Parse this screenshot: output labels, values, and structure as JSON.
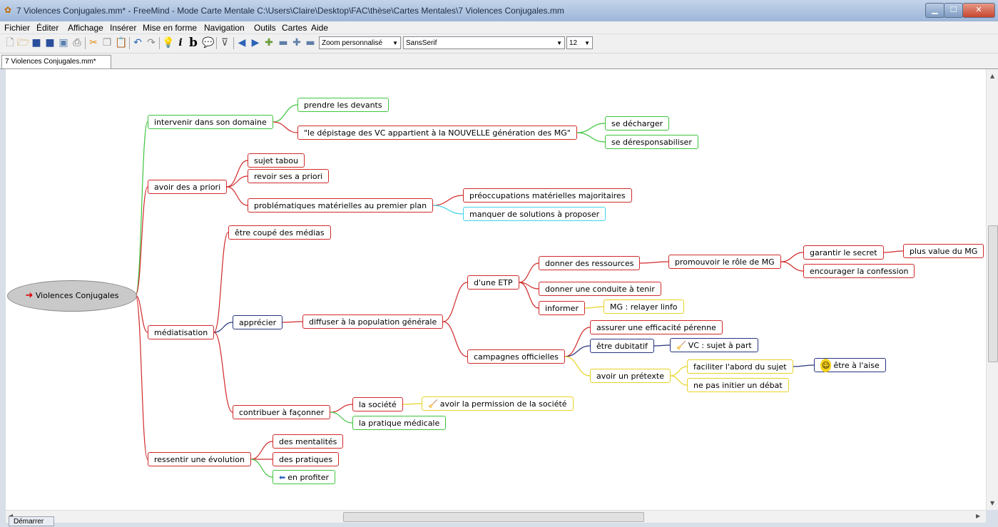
{
  "window": {
    "title": "7 Violences Conjugales.mm* - FreeMind - Mode Carte Mentale C:\\Users\\Claire\\Desktop\\FAC\\thèse\\Cartes Mentales\\7 Violences Conjugales.mm"
  },
  "menu": [
    "Fichier",
    "Éditer",
    "Affichage",
    "Insérer",
    "Mise en forme",
    "Navigation",
    "Outils",
    "Cartes",
    "Aide"
  ],
  "toolbar": {
    "zoom": "Zoom personnalisé",
    "font": "SansSerif",
    "size": "12"
  },
  "tab": {
    "label": "7 Violences Conjugales.mm*"
  },
  "taskbar": {
    "start": "Démarrer"
  },
  "mindmap": {
    "root": "Violences Conjugales",
    "branches": [
      {
        "label": "intervenir dans son domaine",
        "color": "#3ec43e",
        "children": [
          {
            "label": "prendre les devants",
            "color": "#3ec43e"
          },
          {
            "label": "\"le dépistage des VC appartient à la NOUVELLE génération des MG\"",
            "color": "#d12a2a",
            "children": [
              {
                "label": "se décharger",
                "color": "#3ec43e"
              },
              {
                "label": "se déresponsabiliser",
                "color": "#3ec43e"
              }
            ]
          }
        ]
      },
      {
        "label": "avoir des a priori",
        "color": "#d12a2a",
        "children": [
          {
            "label": "sujet tabou",
            "color": "#d12a2a"
          },
          {
            "label": "revoir ses a priori",
            "color": "#d12a2a"
          },
          {
            "label": "problématiques matérielles au premier plan",
            "color": "#d12a2a",
            "children": [
              {
                "label": "préoccupations matérielles majoritaires",
                "color": "#d12a2a"
              },
              {
                "label": "manquer de solutions à proposer",
                "color": "#3fd6e6"
              }
            ]
          }
        ]
      },
      {
        "label": "médiatisation",
        "color": "#d12a2a",
        "children": [
          {
            "label": "être coupé des médias",
            "color": "#d12a2a"
          },
          {
            "label": "apprécier",
            "color": "#27357c",
            "children": [
              {
                "label": "diffuser à la population générale",
                "color": "#d12a2a",
                "children": [
                  {
                    "label": "d'une ETP",
                    "color": "#d12a2a",
                    "children": [
                      {
                        "label": "donner des ressources",
                        "color": "#d12a2a",
                        "children": [
                          {
                            "label": "promouvoir le rôle de MG",
                            "color": "#d12a2a",
                            "children": [
                              {
                                "label": "garantir le secret",
                                "color": "#d12a2a",
                                "children": [
                                  {
                                    "label": "plus value du MG",
                                    "color": "#d12a2a"
                                  }
                                ]
                              },
                              {
                                "label": "encourager la confession",
                                "color": "#d12a2a"
                              }
                            ]
                          }
                        ]
                      },
                      {
                        "label": "donner une conduite à tenir",
                        "color": "#d12a2a"
                      },
                      {
                        "label": "informer",
                        "color": "#d12a2a",
                        "children": [
                          {
                            "label": "MG : relayer linfo",
                            "color": "#e8d327"
                          }
                        ]
                      }
                    ]
                  },
                  {
                    "label": "campagnes officielles",
                    "color": "#d12a2a",
                    "children": [
                      {
                        "label": "assurer une efficacité pérenne",
                        "color": "#d12a2a"
                      },
                      {
                        "label": "être dubitatif",
                        "color": "#27357c",
                        "children": [
                          {
                            "label": "VC : sujet à part",
                            "color": "#27357c",
                            "icon": "broom-icon"
                          }
                        ]
                      },
                      {
                        "label": "avoir un prétexte",
                        "color": "#e8d327",
                        "children": [
                          {
                            "label": "faciliter l'abord du sujet",
                            "color": "#e8d327",
                            "children": [
                              {
                                "label": "être à l'aise",
                                "color": "#27357c",
                                "icon": "smiley-icon"
                              }
                            ]
                          },
                          {
                            "label": "ne pas initier un débat",
                            "color": "#e8d327"
                          }
                        ]
                      }
                    ]
                  }
                ]
              }
            ]
          },
          {
            "label": "contribuer à façonner",
            "color": "#d12a2a",
            "children": [
              {
                "label": "la société",
                "color": "#d12a2a",
                "children": [
                  {
                    "label": "avoir la permission de la société",
                    "color": "#e8d327",
                    "icon": "broom-icon"
                  }
                ]
              },
              {
                "label": "la pratique médicale",
                "color": "#3ec43e"
              }
            ]
          }
        ]
      },
      {
        "label": "ressentir une évolution",
        "color": "#d12a2a",
        "children": [
          {
            "label": "des mentalités",
            "color": "#d12a2a"
          },
          {
            "label": "des pratiques",
            "color": "#d12a2a"
          },
          {
            "label": "en profiter",
            "color": "#3ec43e",
            "icon": "back-arrow-icon"
          }
        ]
      }
    ]
  }
}
